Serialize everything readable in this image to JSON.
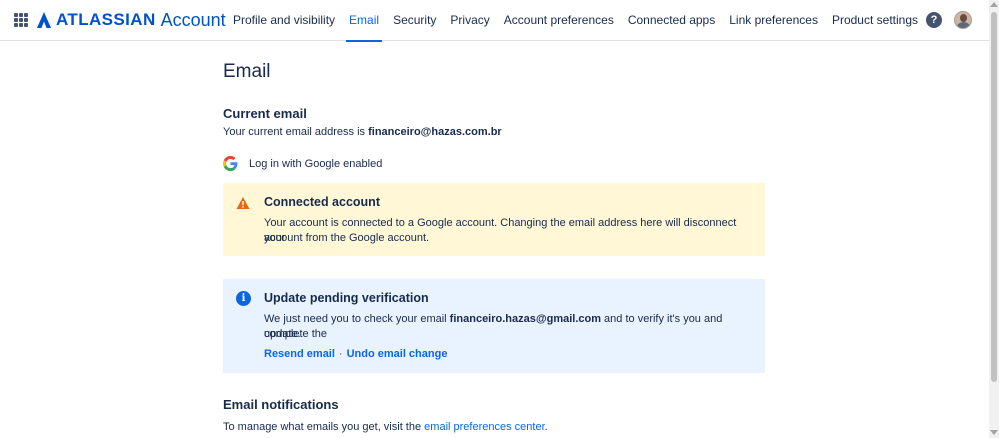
{
  "header": {
    "brand": "ATLASSIAN",
    "product": "Account",
    "tabs": [
      {
        "label": "Profile and visibility"
      },
      {
        "label": "Email"
      },
      {
        "label": "Security"
      },
      {
        "label": "Privacy"
      },
      {
        "label": "Account preferences"
      },
      {
        "label": "Connected apps"
      },
      {
        "label": "Link preferences"
      },
      {
        "label": "Product settings"
      }
    ],
    "active_tab": "Email",
    "help_glyph": "?"
  },
  "page": {
    "title": "Email",
    "current_email": {
      "heading": "Current email",
      "text_prefix": "Your current email address is ",
      "address": "financeiro@hazas.com.br"
    },
    "google": {
      "label": "Log in with Google enabled"
    },
    "connected_banner": {
      "title": "Connected account",
      "line1": "Your account is connected to a Google account. Changing the email address here will disconnect your",
      "line2": "account from the Google account."
    },
    "pending_banner": {
      "title": "Update pending verification",
      "text_prefix": "We just need you to check your email ",
      "email": "financeiro.hazas@gmail.com",
      "text_suffix": " and to verify it's you and complete the",
      "line2": "update.",
      "resend_label": "Resend email",
      "separator": "·",
      "undo_label": "Undo email change",
      "info_glyph": "i"
    },
    "notifications": {
      "heading": "Email notifications",
      "text_prefix": "To manage what emails you get, visit the ",
      "link_label": "email preferences center",
      "text_suffix": "."
    }
  },
  "colors": {
    "brand_blue": "#0052cc",
    "link_blue": "#0c66e4",
    "warning_bg": "#fff7d6",
    "warning_icon": "#e56910",
    "info_bg": "#e9f2ff"
  },
  "icons": {
    "app_switcher": "grid-icon",
    "logo": "atlassian-logo-icon",
    "help": "help-icon",
    "google": "google-g-icon",
    "warning": "warning-triangle-icon",
    "info": "info-circle-icon"
  }
}
